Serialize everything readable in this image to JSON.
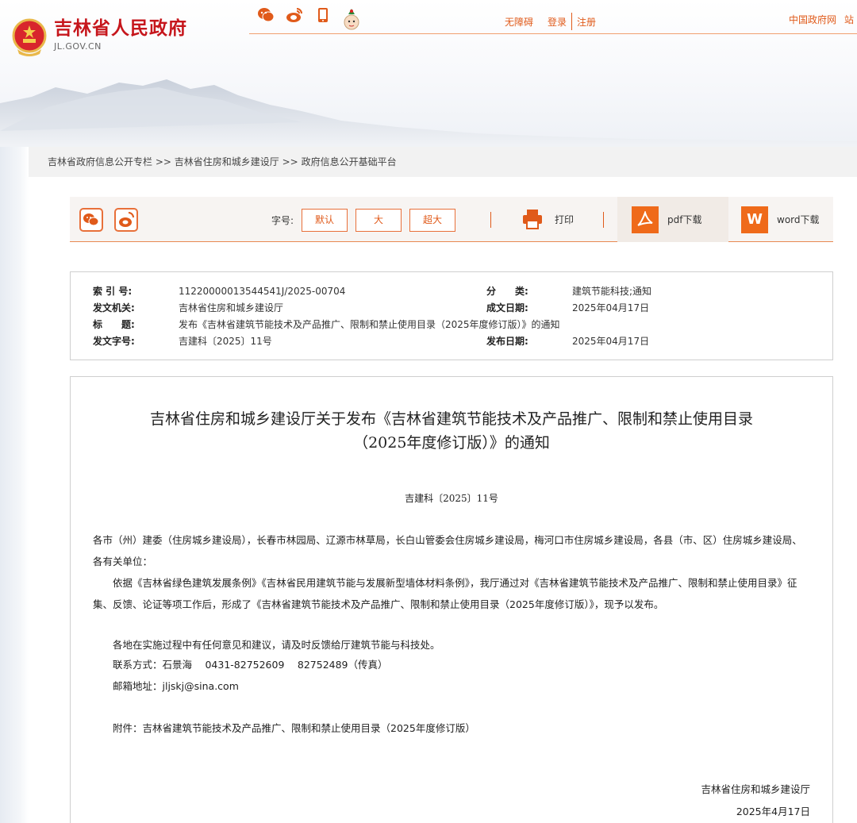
{
  "header": {
    "site_title": "吉林省人民政府",
    "site_domain": "JL.GOV.CN",
    "top_links": {
      "accessibility": "无障碍",
      "login": "登录",
      "register": "注册"
    },
    "right_links": [
      "中国政府网",
      "站"
    ]
  },
  "breadcrumb": [
    "吉林省政府信息公开专栏",
    "吉林省住房和城乡建设厅",
    "政府信息公开基础平台"
  ],
  "breadcrumb_sep": ">>",
  "toolbar": {
    "font_size_label": "字号:",
    "font_default": "默认",
    "font_large": "大",
    "font_xlarge": "超大",
    "print_label": "打印",
    "pdf_label": "pdf下载",
    "word_label": "word下载",
    "word_icon_letter": "W"
  },
  "meta": {
    "index_no_label": "索 引 号:",
    "index_no": "11220000013544541J/2025-00704",
    "category_label": "分　　类:",
    "category": "建筑节能科技;通知",
    "issuer_label": "发文机关:",
    "issuer": "吉林省住房和城乡建设厅",
    "written_date_label": "成文日期:",
    "written_date": "2025年04月17日",
    "title_label": "标　　题:",
    "title": "发布《吉林省建筑节能技术及产品推广、限制和禁止使用目录（2025年度修订版）》的通知",
    "doc_no_label": "发文字号:",
    "doc_no": "吉建科〔2025〕11号",
    "publish_date_label": "发布日期:",
    "publish_date": "2025年04月17日"
  },
  "document": {
    "title_line1": "吉林省住房和城乡建设厅关于发布《吉林省建筑节能技术及产品推广、限制和禁止使用目录",
    "title_line2": "（2025年度修订版）》的通知",
    "doc_number": "吉建科〔2025〕11号",
    "salutation": "各市（州）建委（住房城乡建设局），长春市林园局、辽源市林草局，长白山管委会住房城乡建设局，梅河口市住房城乡建设局，各县（市、区）住房城乡建设局、各有关单位：",
    "body1": "依据《吉林省绿色建筑发展条例》《吉林省民用建筑节能与发展新型墙体材料条例》，我厅通过对《吉林省建筑节能技术及产品推广、限制和禁止使用目录》征集、反馈、论证等项工作后，形成了《吉林省建筑节能技术及产品推广、限制和禁止使用目录（2025年度修订版）》，现予以发布。",
    "body2": "各地在实施过程中有任何意见和建议，请及时反馈给厅建筑节能与科技处。",
    "contact": "联系方式：石景海　 0431-82752609　 82752489（传真）",
    "email": "邮箱地址：jljskj@sina.com",
    "attachment": "附件：吉林省建筑节能技术及产品推广、限制和禁止使用目录（2025年度修订版）",
    "signer": "吉林省住房和城乡建设厅",
    "sign_date": "2025年4月17日"
  },
  "colors": {
    "accent": "#e05a1a",
    "brand_red": "#c6161c",
    "icon_orange": "#ef6a1a"
  }
}
